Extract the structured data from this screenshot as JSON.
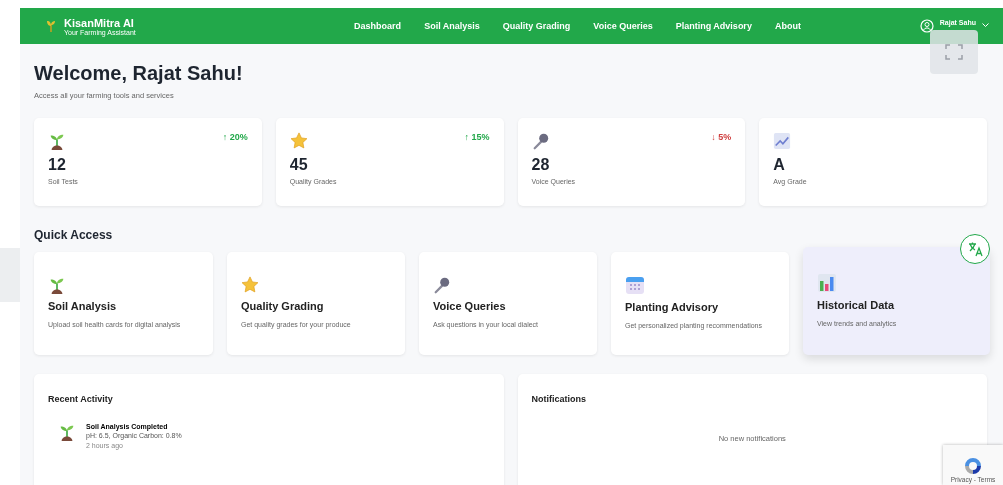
{
  "header": {
    "brand": "KisanMitra AI",
    "tagline": "Your Farming Assistant",
    "nav": [
      {
        "label": "Dashboard"
      },
      {
        "label": "Soil Analysis"
      },
      {
        "label": "Quality Grading"
      },
      {
        "label": "Voice Queries"
      },
      {
        "label": "Planting Advisory"
      },
      {
        "label": "About"
      }
    ],
    "user": "Rajat Sahu"
  },
  "welcome": {
    "title": "Welcome, Rajat Sahu!",
    "subtitle": "Access all your farming tools and services"
  },
  "stats": [
    {
      "value": "12",
      "label": "Soil Tests",
      "trend": "↑ 20%",
      "color": "#22a84a"
    },
    {
      "value": "45",
      "label": "Quality Grades",
      "trend": "↑ 15%",
      "color": "#22a84a"
    },
    {
      "value": "28",
      "label": "Voice Queries",
      "trend": "↓ 5%",
      "color": "#d04040"
    },
    {
      "value": "A",
      "label": "Avg Grade"
    }
  ],
  "quick_access": {
    "title": "Quick Access",
    "items": [
      {
        "title": "Soil Analysis",
        "description": "Upload soil health cards for digital analysis",
        "highlighted": false
      },
      {
        "title": "Quality Grading",
        "description": "Get quality grades for your produce",
        "highlighted": false
      },
      {
        "title": "Voice Queries",
        "description": "Ask questions in your local dialect",
        "highlighted": false
      },
      {
        "title": "Planting Advisory",
        "description": "Get personalized planting recommendations",
        "highlighted": false
      },
      {
        "title": "Historical Data",
        "description": "View trends and analytics",
        "highlighted": true
      }
    ]
  },
  "recent_activity": {
    "title": "Recent Activity",
    "items": [
      {
        "title": "Soil Analysis Completed",
        "detail": "pH: 6.5, Organic Carbon: 0.8%",
        "time": "2 hours ago"
      }
    ]
  },
  "notifications": {
    "title": "Notifications",
    "empty_text": "No new notifications"
  },
  "recaptcha": {
    "links": "Privacy - Terms"
  }
}
